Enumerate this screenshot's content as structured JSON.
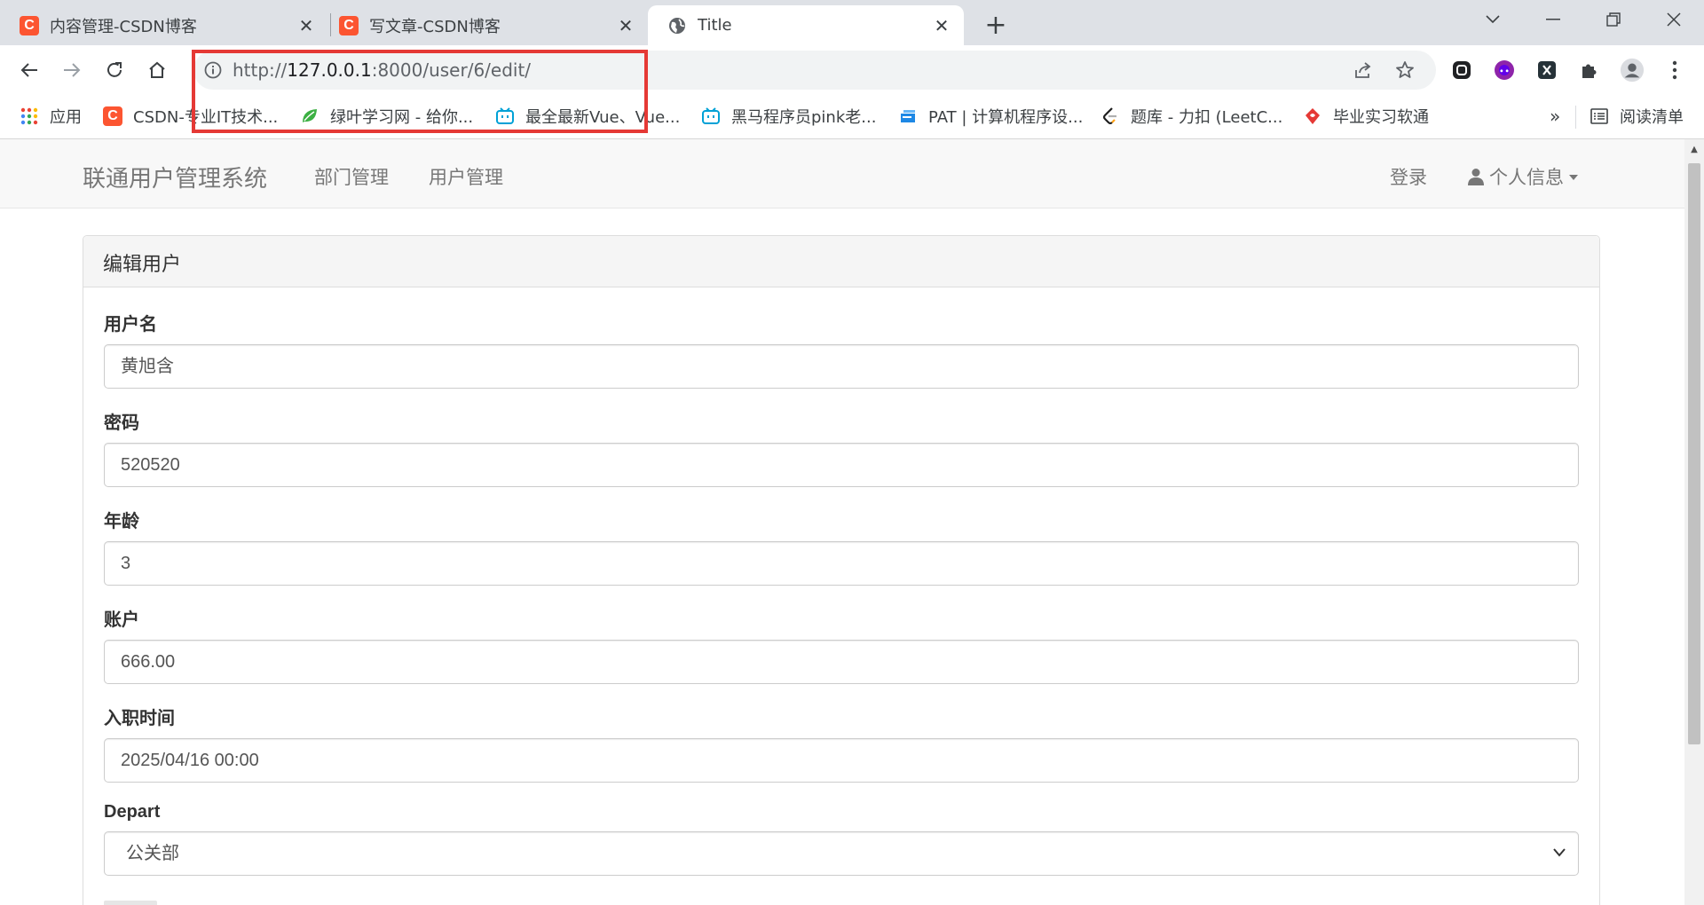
{
  "tabs": [
    {
      "title": "内容管理-CSDN博客",
      "favicon": "csdn-icon"
    },
    {
      "title": "写文章-CSDN博客",
      "favicon": "csdn-icon"
    },
    {
      "title": "Title",
      "favicon": "globe-icon",
      "active": true
    }
  ],
  "address_bar": {
    "url_prefix": "http://",
    "url_host": "127.0.0.1",
    "url_rest": ":8000/user/6/edit/"
  },
  "bookmarks": {
    "apps": "应用",
    "items": [
      "CSDN-专业IT技术...",
      "绿叶学习网 - 给你...",
      "最全最新Vue、Vue...",
      "黑马程序员pink老...",
      "PAT | 计算机程序设...",
      "题库 - 力扣 (LeetC...",
      "毕业实习软通"
    ],
    "overflow": "»",
    "reading_list": "阅读清单"
  },
  "site_nav": {
    "brand": "联通用户管理系统",
    "links": [
      "部门管理",
      "用户管理"
    ],
    "login": "登录",
    "profile": "个人信息"
  },
  "panel": {
    "heading": "编辑用户",
    "fields": [
      {
        "label": "用户名",
        "value": "黄旭含"
      },
      {
        "label": "密码",
        "value": "520520"
      },
      {
        "label": "年龄",
        "value": "3"
      },
      {
        "label": "账户",
        "value": "666.00"
      },
      {
        "label": "入职时间",
        "value": "2025/04/16 00:00"
      },
      {
        "label": "Depart",
        "value": "公关部",
        "type": "select"
      }
    ]
  },
  "colors": {
    "csdn": "#fc5531",
    "highlight": "#e53935",
    "tabstrip": "#dee1e6"
  }
}
